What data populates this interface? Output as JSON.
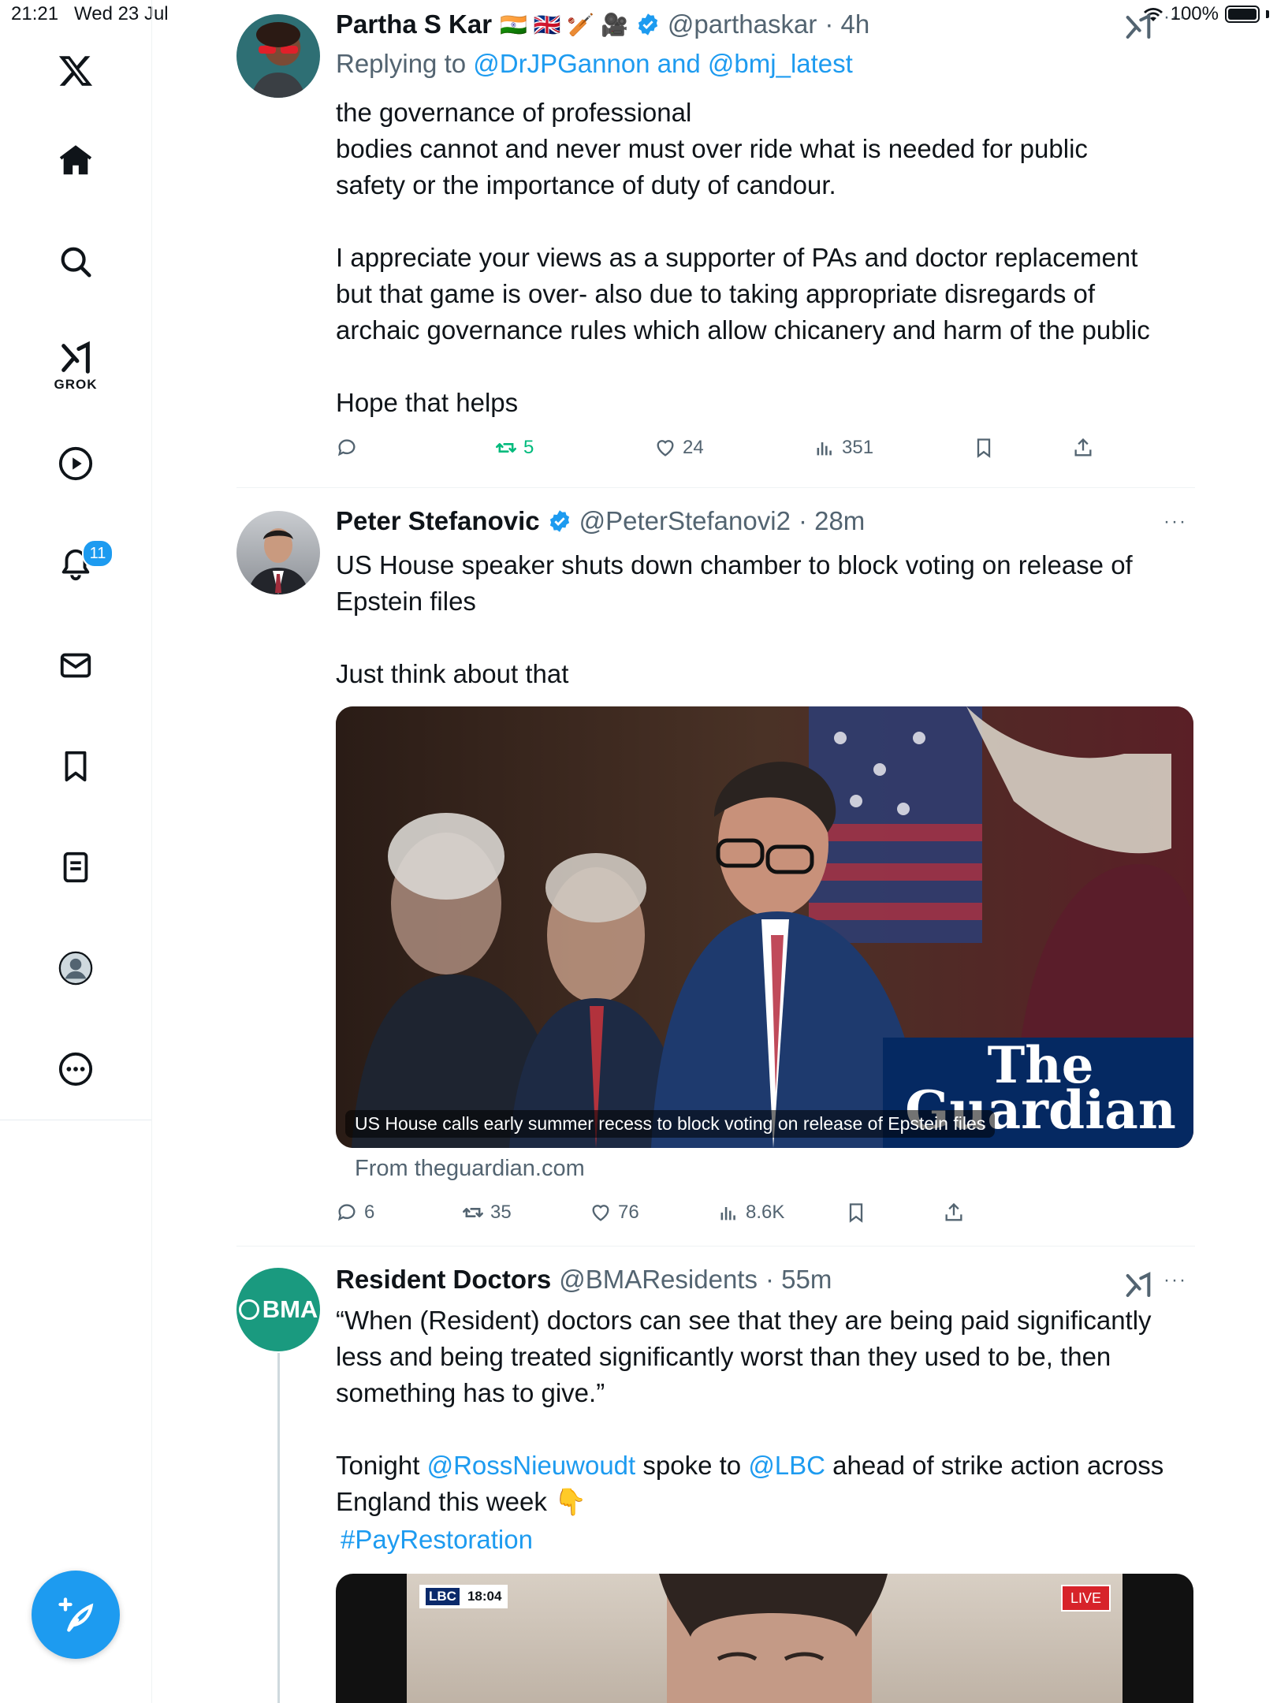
{
  "status_bar": {
    "time": "21:21",
    "date": "Wed 23 Jul",
    "battery": "100%"
  },
  "sidebar": {
    "items": [
      {
        "name": "x-logo-icon"
      },
      {
        "name": "home-icon"
      },
      {
        "name": "search-icon"
      },
      {
        "name": "grok-icon",
        "label": "GROK"
      },
      {
        "name": "video-icon"
      },
      {
        "name": "notifications-icon",
        "badge": "11"
      },
      {
        "name": "messages-icon"
      },
      {
        "name": "bookmarks-icon"
      },
      {
        "name": "lists-icon"
      },
      {
        "name": "profile-icon"
      },
      {
        "name": "more-icon"
      }
    ],
    "compose": "compose-post-icon"
  },
  "tweets": [
    {
      "name": "Partha S Kar",
      "emoji_flags": "🇮🇳 🇬🇧 🏏 🎥",
      "handle": "@parthaskar",
      "time": "· 4h",
      "replying_prefix": "Replying to ",
      "replying_users": "@DrJPGannon and @bmj_latest",
      "text": "the governance of professional\nbodies cannot and never must over ride what is needed for public\nsafety or the importance of duty of candour.\n\nI appreciate your views as a supporter of PAs and doctor replacement\nbut that game is over- also due to taking appropriate disregards of\narchaic governance rules which allow chicanery and harm of the public\n\nHope that helps",
      "replies": "",
      "reposts": "5",
      "likes": "24",
      "views": "351"
    },
    {
      "name": "Peter Stefanovic",
      "handle": "@PeterStefanovi2",
      "time": "· 28m",
      "text": "US House speaker shuts down chamber to block voting on release of\nEpstein files\n\nJust think about that",
      "card_caption": "US House calls early summer recess to block voting on release of Epstein files",
      "card_logo_line1": "The",
      "card_logo_line2": "Guardian",
      "card_source": "From theguardian.com",
      "replies": "6",
      "reposts": "35",
      "likes": "76",
      "views": "8.6K"
    },
    {
      "name": "Resident Doctors",
      "handle": "@BMAResidents",
      "time": "· 55m",
      "avatar_text": "BMA",
      "text_line1": "“When (Resident) doctors can see that they are being paid significantly\nless and being treated significantly worst than they used to be, then\nsomething has to give.”",
      "text_tonight": "Tonight ",
      "mention1": "@RossNieuwoudt",
      "text_spoke": " spoke to ",
      "mention2": "@LBC",
      "text_ahead": " ahead of strike action across\nEngland this week 👇",
      "hashtag": "#PayRestoration",
      "video_logo": "LBC",
      "video_time": "18:04",
      "video_live": "LIVE"
    }
  ],
  "colors": {
    "accent": "#1d9bf0",
    "repost_active": "#00ba7c",
    "bma": "#1a9a7f"
  }
}
